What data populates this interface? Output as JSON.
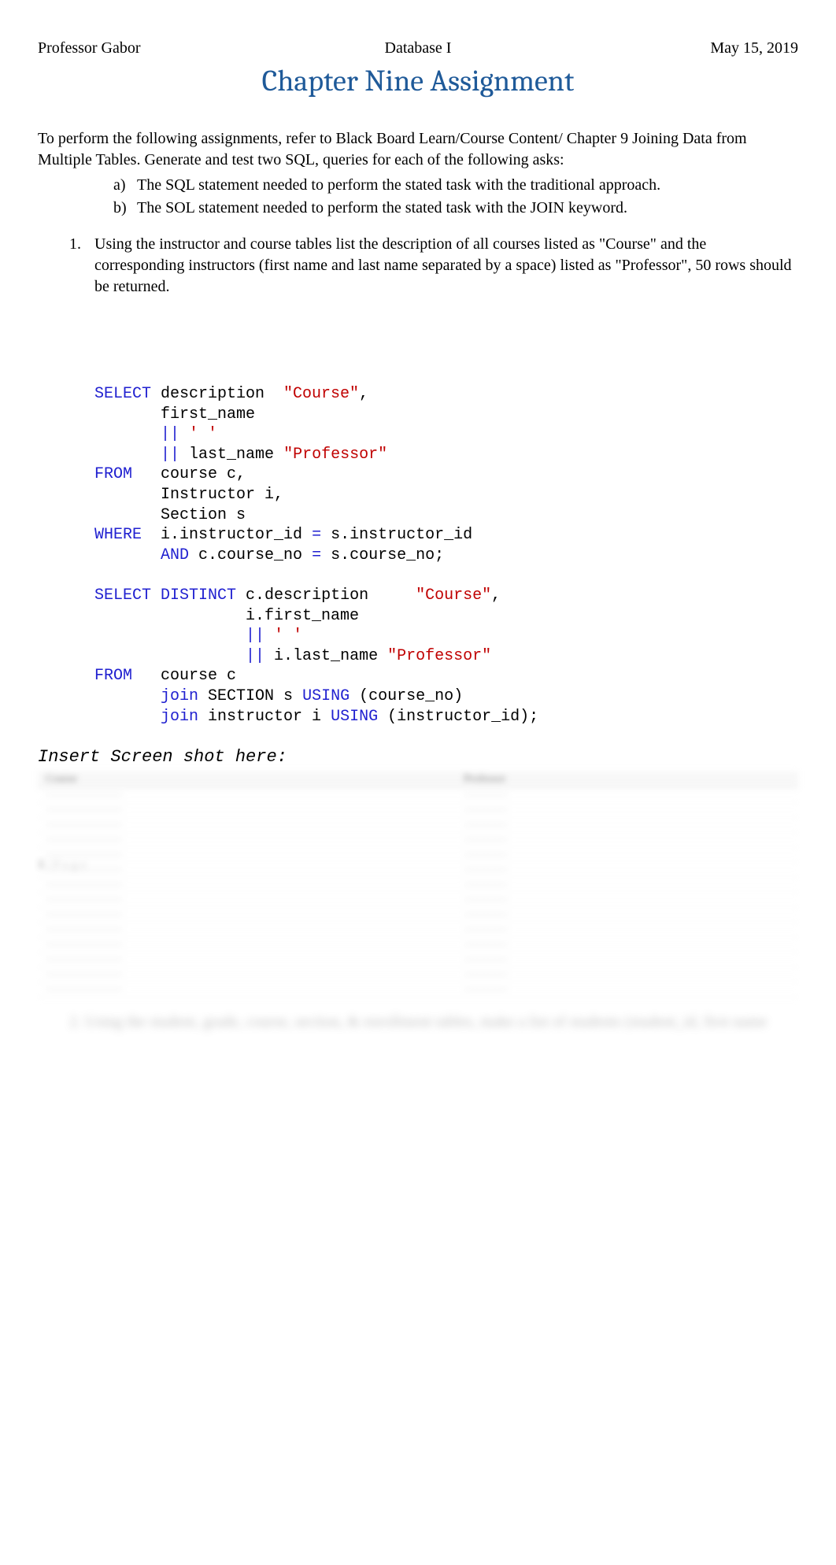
{
  "header": {
    "left": "Professor Gabor",
    "center": "Database I",
    "right": "May 15, 2019"
  },
  "title": "Chapter Nine Assignment",
  "intro": "To perform the following assignments, refer to Black Board Learn/Course Content/ Chapter 9 Joining Data from Multiple Tables. Generate and test two SQL, queries for each of the following asks:",
  "sub_items": [
    {
      "marker": "a)",
      "text": "The SQL statement needed to perform the stated task with the traditional approach."
    },
    {
      "marker": "b)",
      "text": "The SOL statement needed to perform the stated task with the JOIN keyword."
    }
  ],
  "question": {
    "marker": "1.",
    "text": "Using the instructor and course tables list the description of all courses listed as \"Course\" and the corresponding instructors (first name and last name separated by a space) listed as \"Professor\", 50 rows should be returned."
  },
  "code": {
    "tokens": [
      {
        "t": "SELECT",
        "c": "kw"
      },
      {
        "t": " description  ",
        "c": "txt"
      },
      {
        "t": "\"Course\"",
        "c": "str"
      },
      {
        "t": ",\n",
        "c": "txt"
      },
      {
        "t": "       first_name\n",
        "c": "txt"
      },
      {
        "t": "       ",
        "c": "txt"
      },
      {
        "t": "||",
        "c": "kw"
      },
      {
        "t": " ",
        "c": "txt"
      },
      {
        "t": "' '",
        "c": "str"
      },
      {
        "t": "\n",
        "c": "txt"
      },
      {
        "t": "       ",
        "c": "txt"
      },
      {
        "t": "||",
        "c": "kw"
      },
      {
        "t": " last_name ",
        "c": "txt"
      },
      {
        "t": "\"Professor\"",
        "c": "str"
      },
      {
        "t": "\n",
        "c": "txt"
      },
      {
        "t": "FROM",
        "c": "kw"
      },
      {
        "t": "   course c,\n",
        "c": "txt"
      },
      {
        "t": "       Instructor i,\n",
        "c": "txt"
      },
      {
        "t": "       Section s\n",
        "c": "txt"
      },
      {
        "t": "WHERE",
        "c": "kw"
      },
      {
        "t": "  i.instructor_id ",
        "c": "txt"
      },
      {
        "t": "=",
        "c": "kw"
      },
      {
        "t": " s.instructor_id\n",
        "c": "txt"
      },
      {
        "t": "       ",
        "c": "txt"
      },
      {
        "t": "AND",
        "c": "kw"
      },
      {
        "t": " c.course_no ",
        "c": "txt"
      },
      {
        "t": "=",
        "c": "kw"
      },
      {
        "t": " s.course_no;\n",
        "c": "txt"
      },
      {
        "t": "\n",
        "c": "txt"
      },
      {
        "t": "SELECT",
        "c": "kw"
      },
      {
        "t": " ",
        "c": "txt"
      },
      {
        "t": "DISTINCT",
        "c": "kw"
      },
      {
        "t": " c.description     ",
        "c": "txt"
      },
      {
        "t": "\"Course\"",
        "c": "str"
      },
      {
        "t": ",\n",
        "c": "txt"
      },
      {
        "t": "                i.first_name\n",
        "c": "txt"
      },
      {
        "t": "                ",
        "c": "txt"
      },
      {
        "t": "||",
        "c": "kw"
      },
      {
        "t": " ",
        "c": "txt"
      },
      {
        "t": "' '",
        "c": "str"
      },
      {
        "t": "\n",
        "c": "txt"
      },
      {
        "t": "                ",
        "c": "txt"
      },
      {
        "t": "||",
        "c": "kw"
      },
      {
        "t": " i.last_name ",
        "c": "txt"
      },
      {
        "t": "\"Professor\"",
        "c": "str"
      },
      {
        "t": "\n",
        "c": "txt"
      },
      {
        "t": "FROM",
        "c": "kw"
      },
      {
        "t": "   course c\n",
        "c": "txt"
      },
      {
        "t": "       ",
        "c": "txt"
      },
      {
        "t": "join",
        "c": "kw"
      },
      {
        "t": " SECTION s ",
        "c": "txt"
      },
      {
        "t": "USING",
        "c": "kw"
      },
      {
        "t": " (course_no)\n",
        "c": "txt"
      },
      {
        "t": "       ",
        "c": "txt"
      },
      {
        "t": "join",
        "c": "kw"
      },
      {
        "t": " instructor i ",
        "c": "txt"
      },
      {
        "t": "USING",
        "c": "kw"
      },
      {
        "t": " (instructor_id);",
        "c": "txt"
      }
    ]
  },
  "screenshot_label": "Insert Screen shot here:",
  "table": {
    "headers": [
      "Course",
      "Professor"
    ],
    "rows": [
      [
        "",
        ""
      ],
      [
        "",
        ""
      ],
      [
        "",
        ""
      ],
      [
        "",
        ""
      ],
      [
        "",
        ""
      ],
      [
        "",
        ""
      ],
      [
        "",
        ""
      ],
      [
        "",
        ""
      ],
      [
        "",
        ""
      ],
      [
        "",
        ""
      ],
      [
        "",
        ""
      ],
      [
        "",
        ""
      ],
      [
        "",
        ""
      ],
      [
        "",
        ""
      ]
    ]
  },
  "blur_question": "2.  Using the student, grade, course, section, & enrollment tables, make a list of students (student_id, first name",
  "page_number": {
    "current": "1",
    "sep": " | ",
    "label": "P a g e"
  }
}
